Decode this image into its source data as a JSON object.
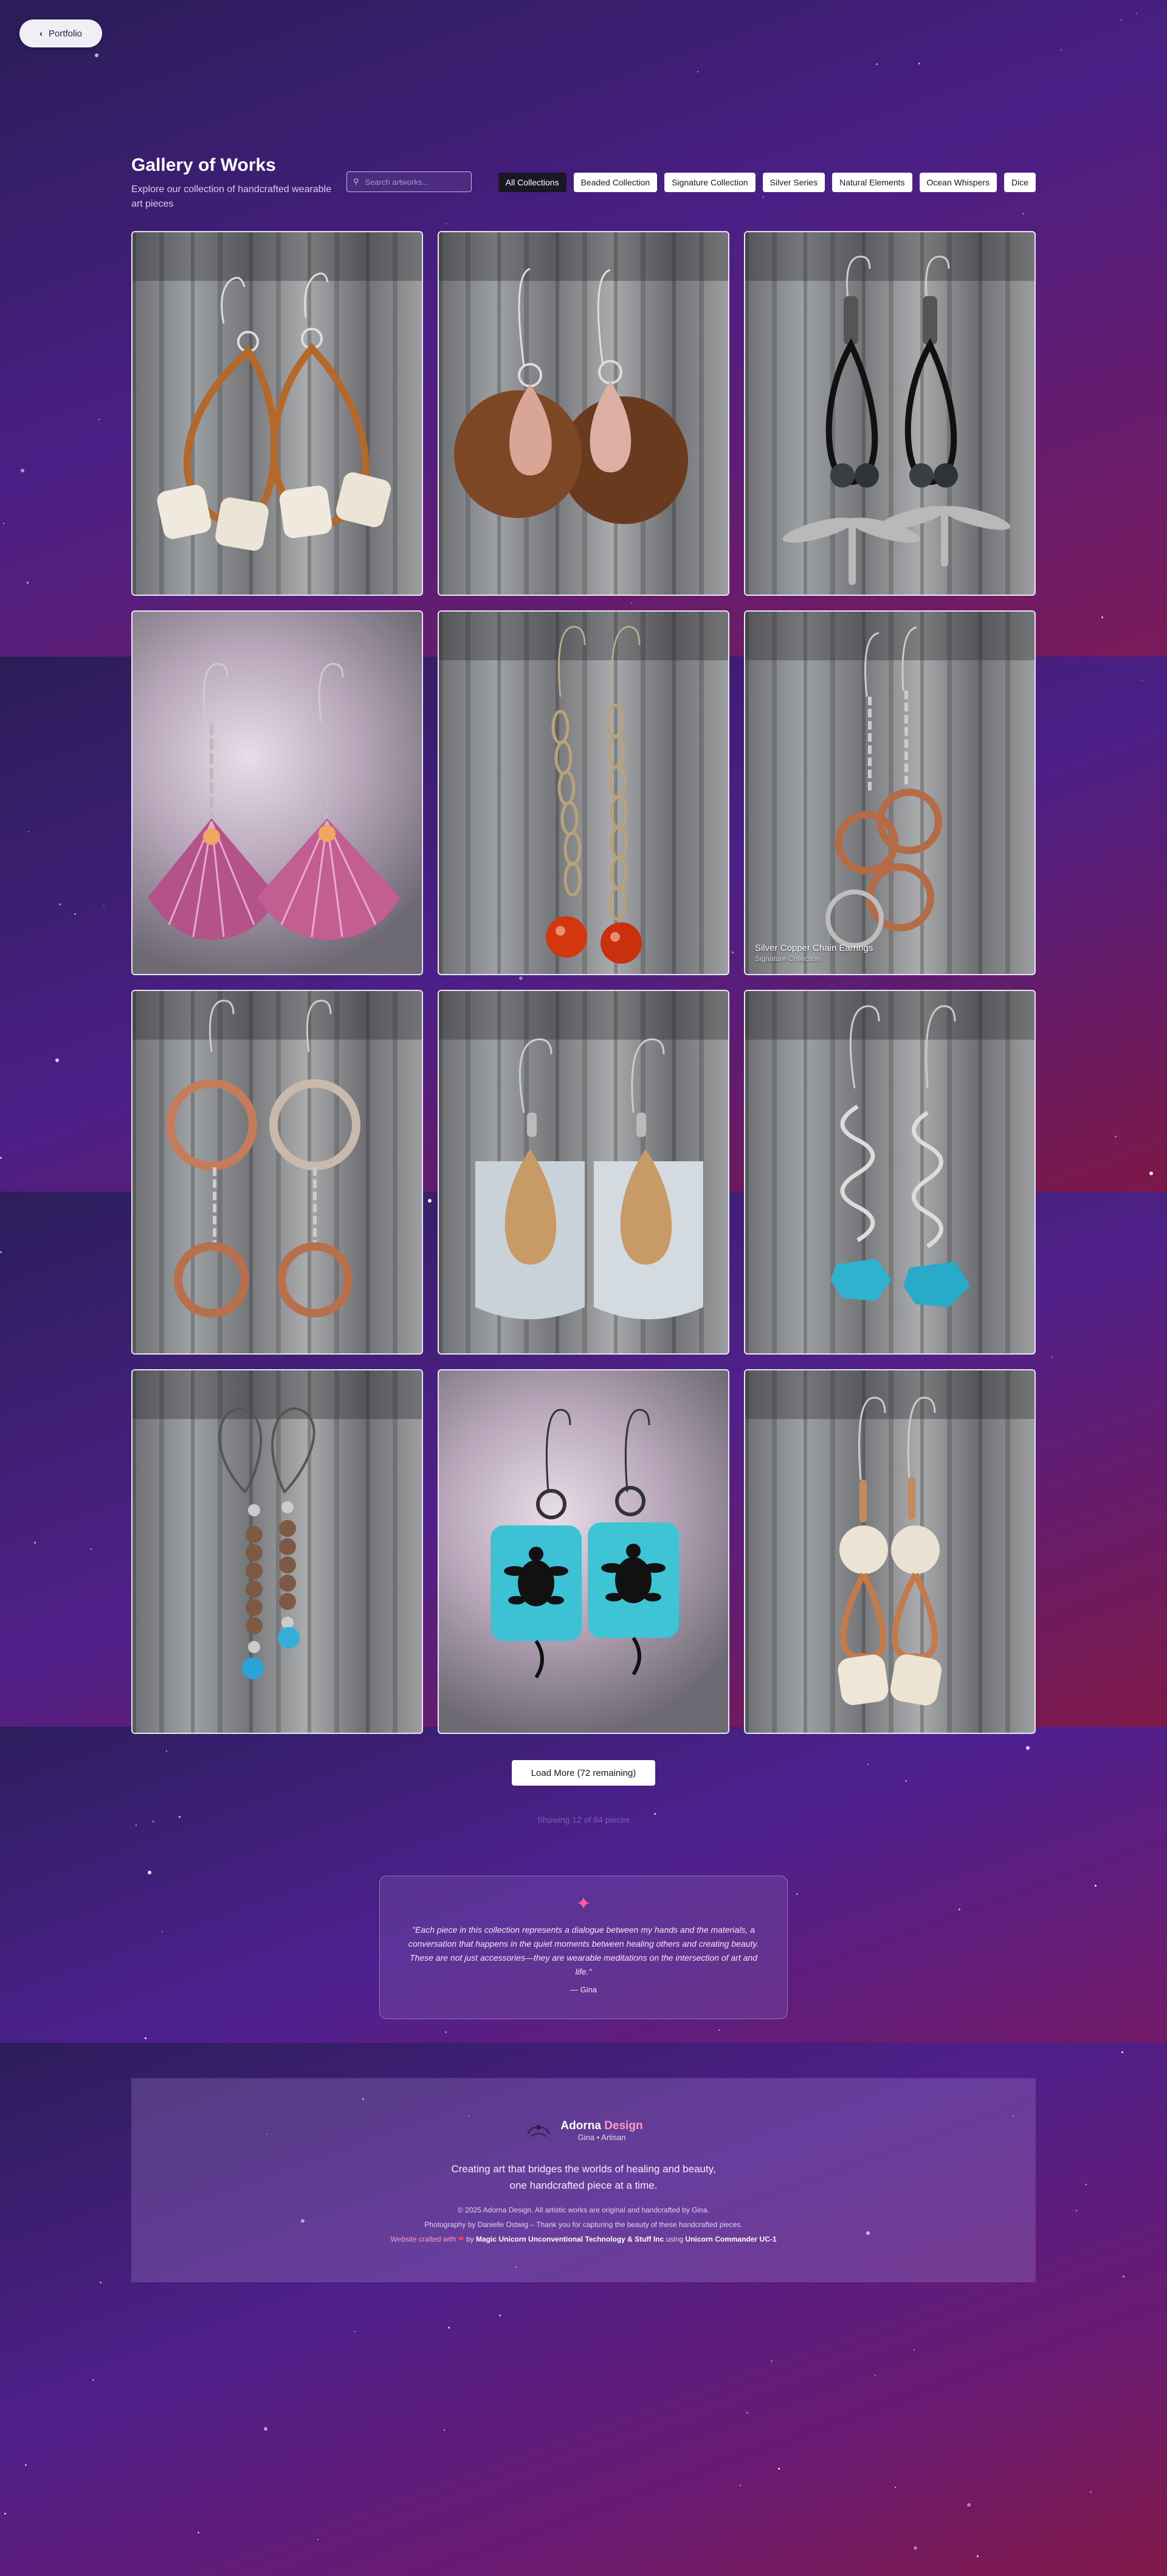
{
  "nav": {
    "back_label": "Portfolio",
    "back_icon": "chevron-left-icon"
  },
  "header": {
    "title": "Gallery of Works",
    "subtitle": "Explore our collection of handcrafted wearable art pieces",
    "search_placeholder": "Search artworks...",
    "search_value": ""
  },
  "filters": [
    {
      "label": "All Collections",
      "active": true
    },
    {
      "label": "Beaded Collection",
      "active": false
    },
    {
      "label": "Signature Collection",
      "active": false
    },
    {
      "label": "Silver Series",
      "active": false
    },
    {
      "label": "Natural Elements",
      "active": false
    },
    {
      "label": "Ocean Whispers",
      "active": false
    },
    {
      "label": "Dice",
      "active": false
    }
  ],
  "gallery": [
    {
      "image": "earrings-leather-teardrop-white-beads"
    },
    {
      "image": "earrings-copper-disc-teardrop"
    },
    {
      "image": "earrings-black-cord-dragonfly"
    },
    {
      "image": "earrings-purple-scallop-shell"
    },
    {
      "image": "earrings-chain-orange-bead"
    },
    {
      "image": "earrings-silver-copper-rings",
      "title": "Silver Copper Chain Earrings",
      "collection": "Signature Collection"
    },
    {
      "image": "earrings-copper-hoop-rings"
    },
    {
      "image": "earrings-silver-tag-copper-teardrop"
    },
    {
      "image": "earrings-silver-spiral-turquoise"
    },
    {
      "image": "earrings-wood-bead-turquoise"
    },
    {
      "image": "earrings-turquoise-turtle"
    },
    {
      "image": "earrings-bone-bead-copper-loop"
    }
  ],
  "load_more": {
    "label": "Load More (72 remaining)"
  },
  "status": {
    "showing": "Showing 12 of 84 pieces"
  },
  "quote": {
    "icon": "sparkle-icon",
    "text": "\"Each piece in this collection represents a dialogue between my hands and the materials, a conversation that happens in the quiet moments between healing others and creating beauty. These are not just accessories—they are wearable meditations on the intersection of art and life.\"",
    "author": "— Gina"
  },
  "footer": {
    "brand_first": "Adorna",
    "brand_second": "Design",
    "brand_sub": "Gina • Artisan",
    "tagline_1": "Creating art that bridges the worlds of healing and beauty,",
    "tagline_2": "one handcrafted piece at a time.",
    "copyright": "© 2025 Adorna Design. All artistic works are original and handcrafted by Gina.",
    "photo_credit": "Photography by Danielle Ostwig – Thank you for capturing the beauty of these handcrafted pieces.",
    "crafted_prefix": "Website crafted with",
    "crafted_by": "by",
    "crafted_company": "Magic Unicorn Unconventional Technology & Stuff Inc",
    "crafted_using": "using",
    "crafted_product": "Unicorn Commander UC-1"
  },
  "colors": {
    "accent_pink": "#ff9cc3",
    "heart": "#ff3b6b",
    "chip_active": "#1b1626"
  }
}
